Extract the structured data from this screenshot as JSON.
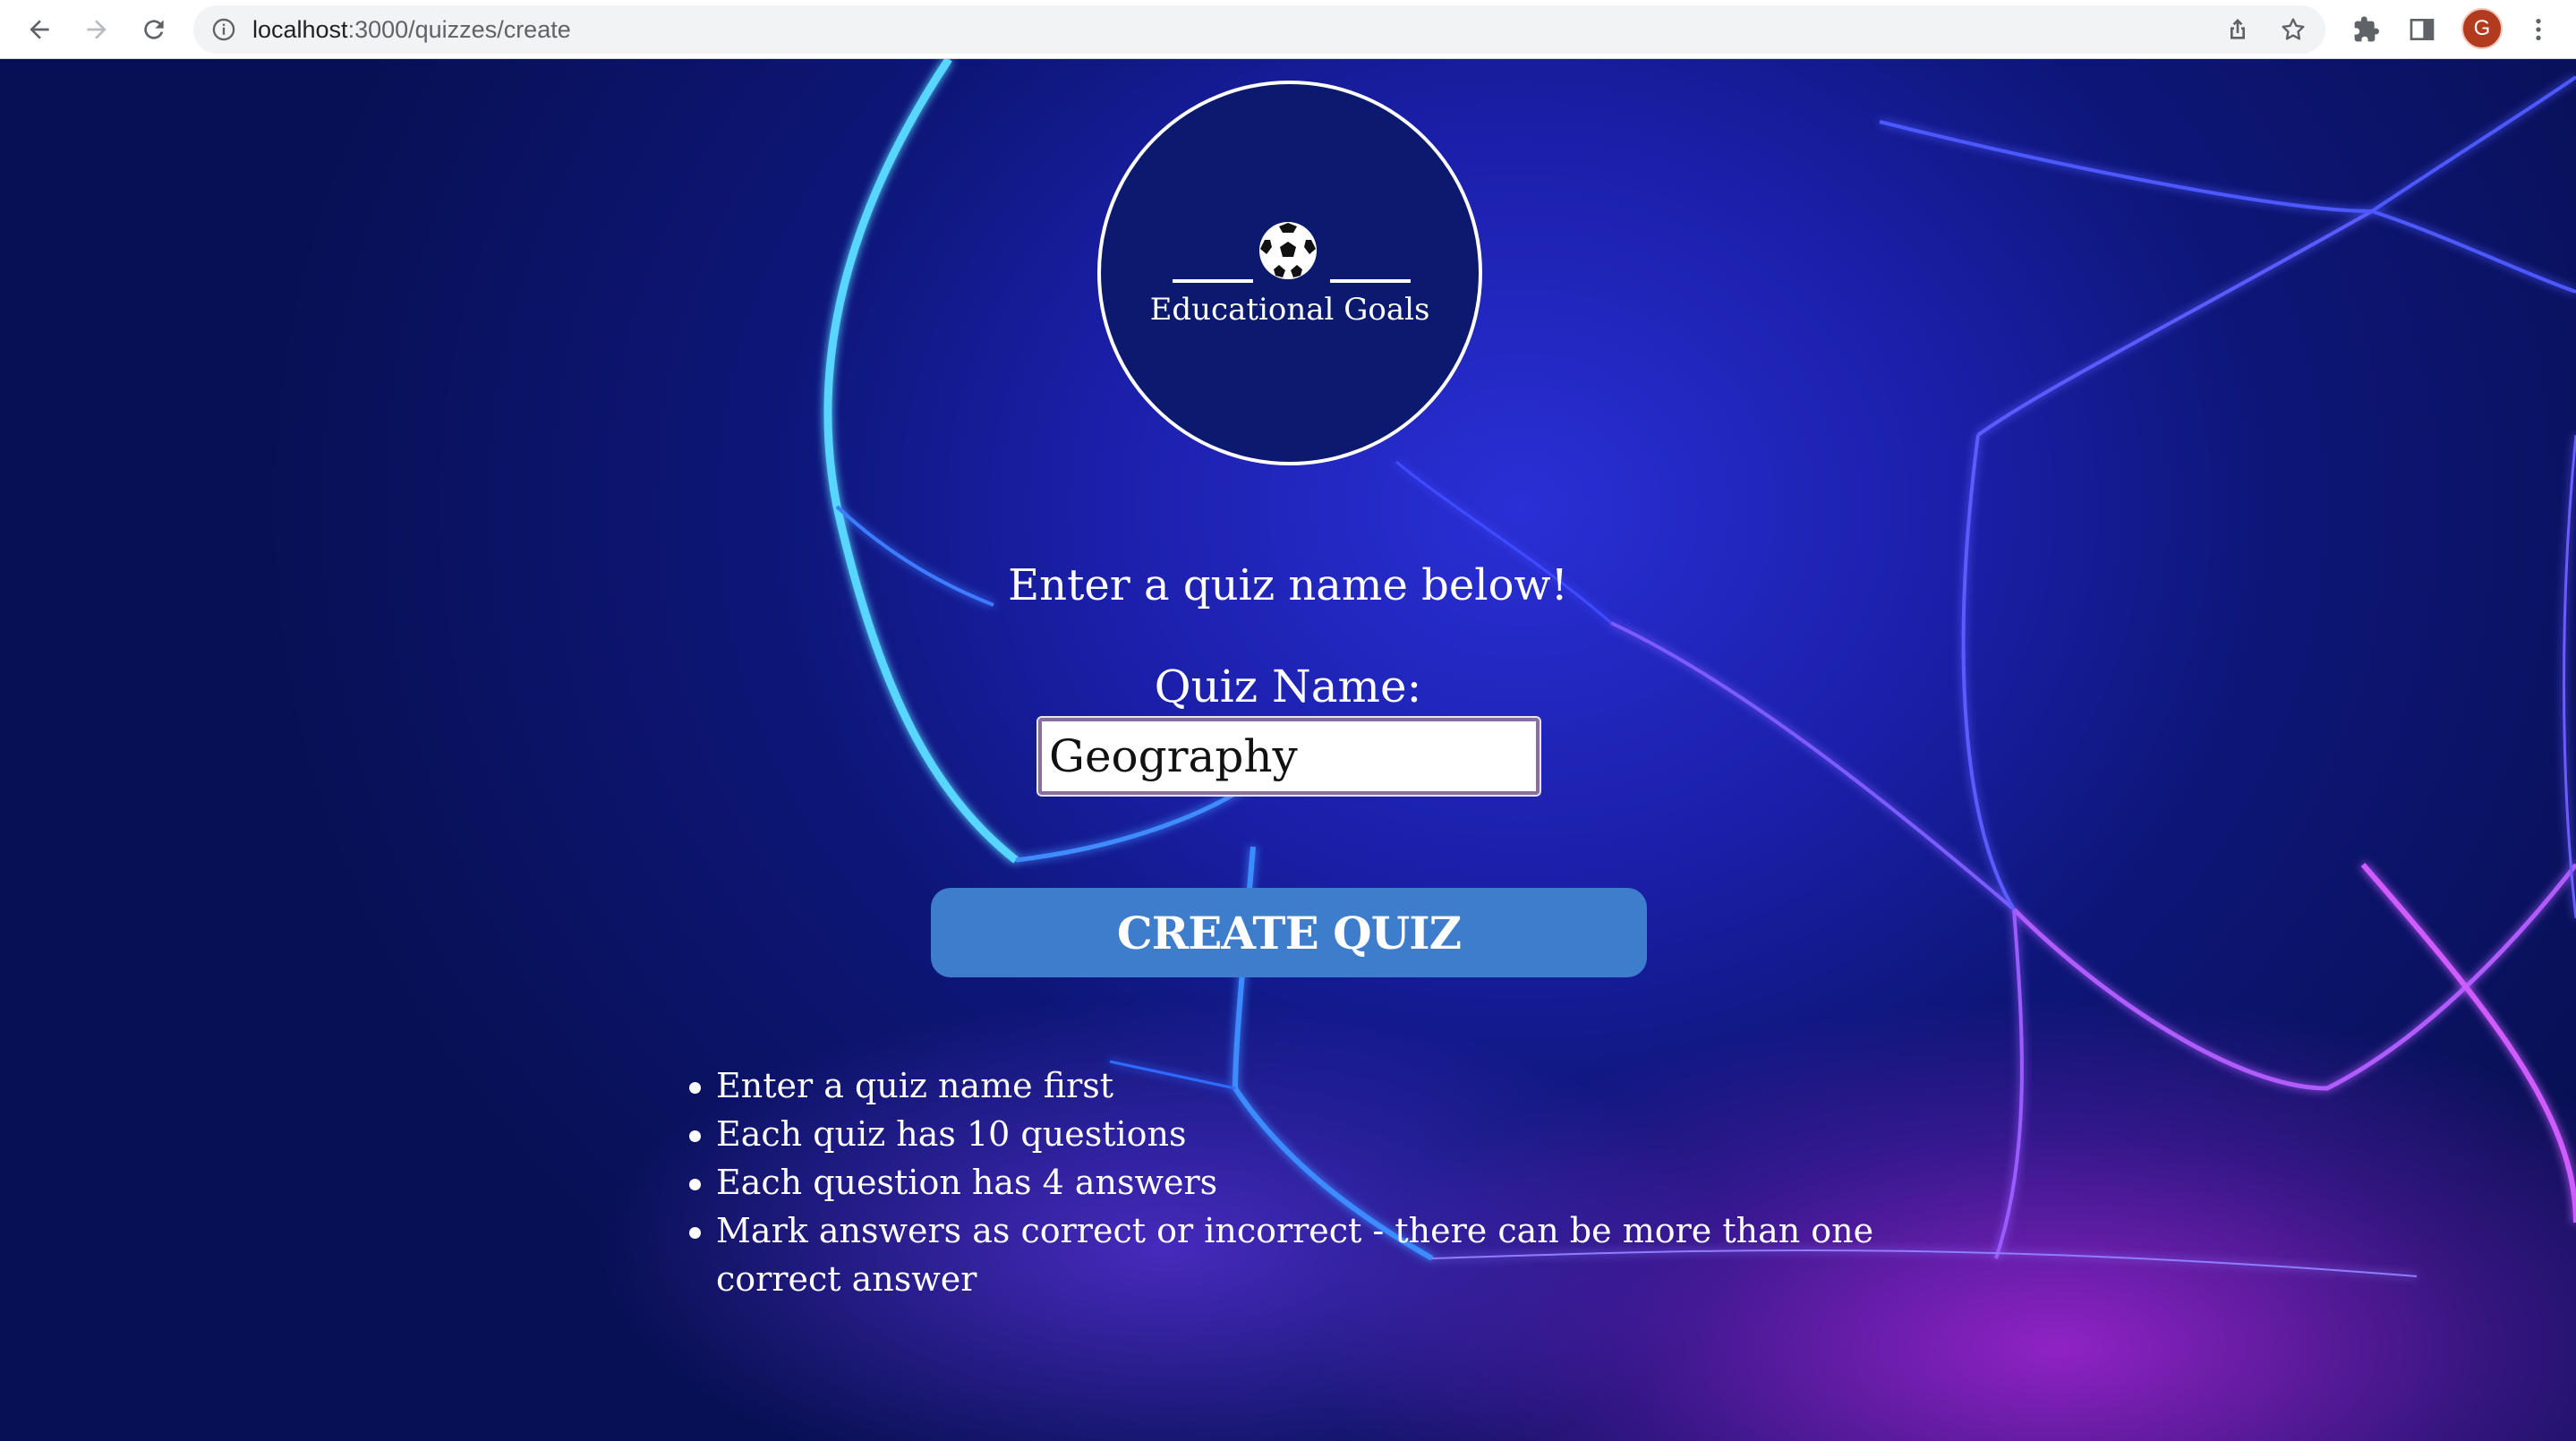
{
  "browser": {
    "url_host": "localhost",
    "url_path": ":3000/quizzes/create",
    "avatar_letter": "G"
  },
  "logo": {
    "brand": "Educational Goals",
    "icon": "soccer-ball-icon"
  },
  "form": {
    "heading": "Enter a quiz name below!",
    "label": "Quiz Name:",
    "quiz_name_value": "Geography",
    "submit_label": "CREATE QUIZ"
  },
  "rules": [
    "Enter a quiz name first",
    "Each quiz has 10 questions",
    "Each question has 4 answers",
    "Mark answers as correct or incorrect - there can be more than one correct answer"
  ]
}
